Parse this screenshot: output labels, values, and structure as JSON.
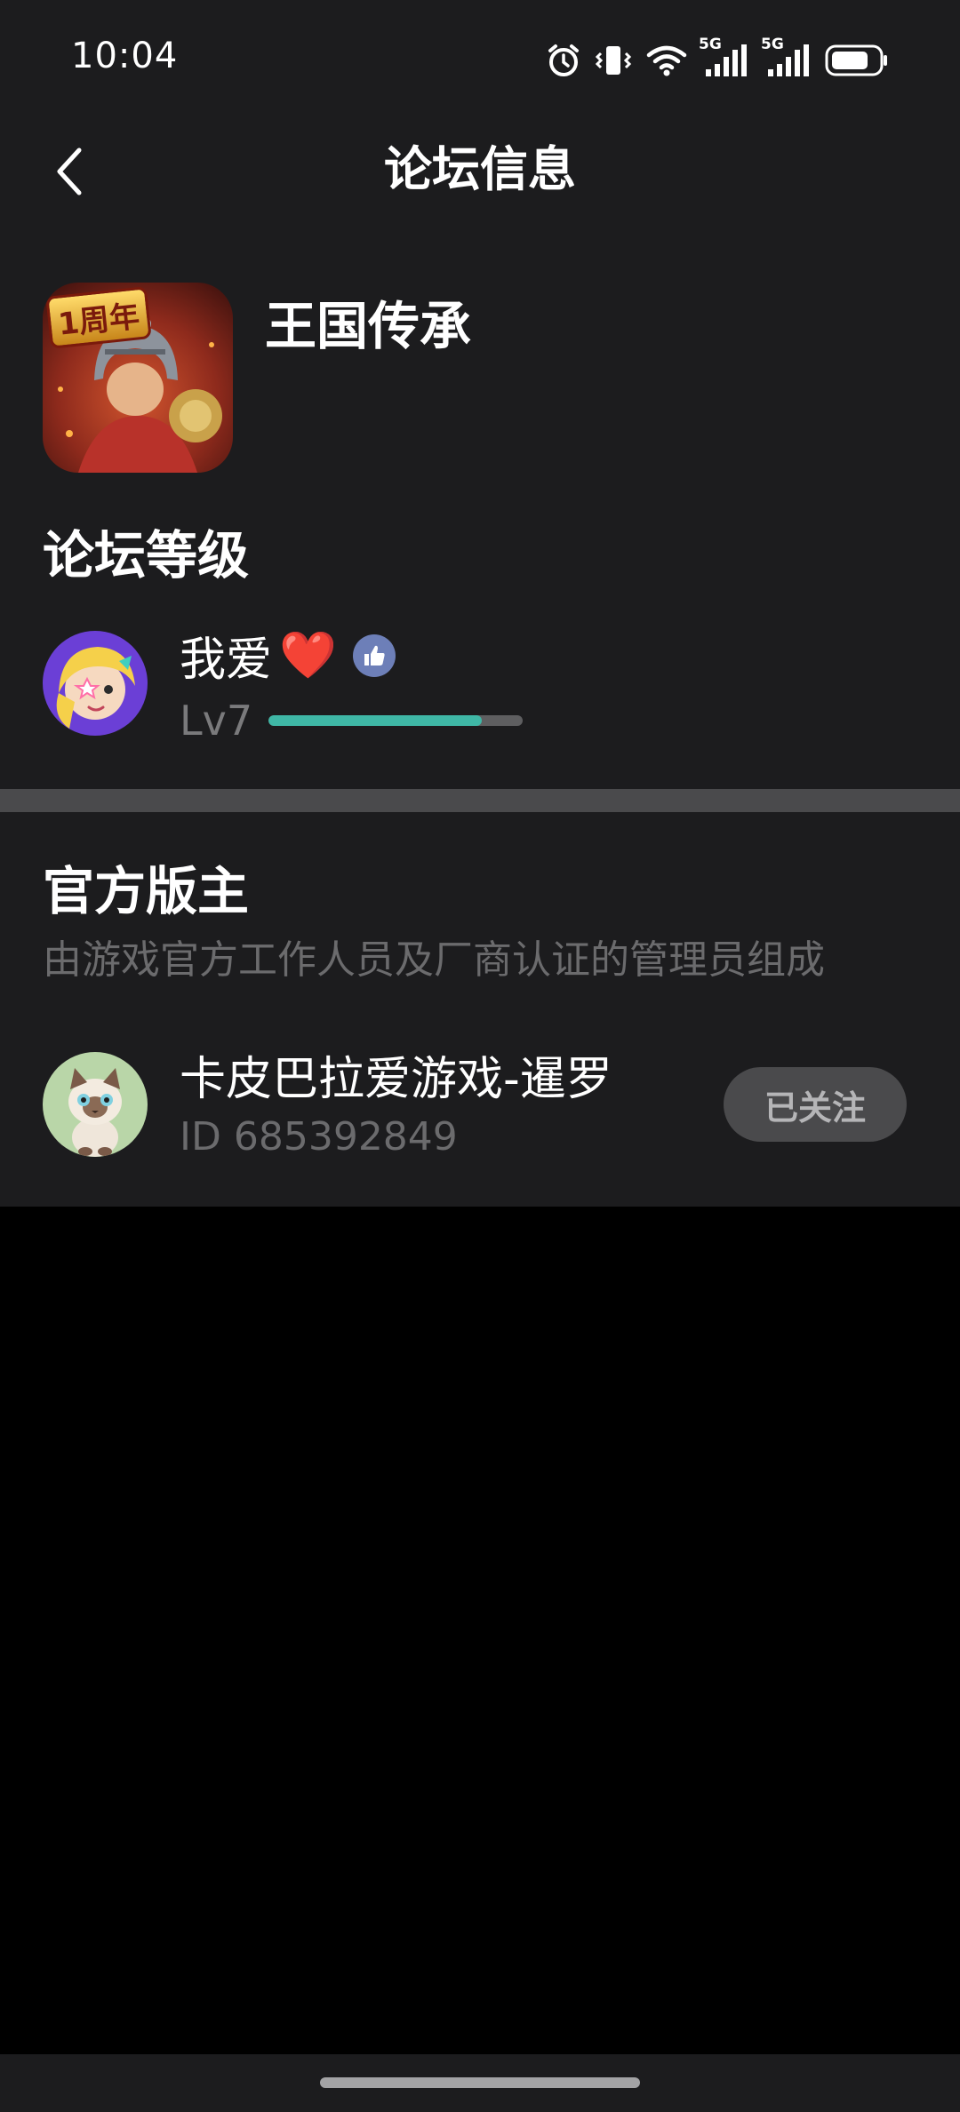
{
  "status_bar": {
    "time": "10:04",
    "network_1": "5G",
    "network_2": "5G",
    "icons": [
      "alarm-icon",
      "vibrate-icon",
      "wifi-icon",
      "signal-icon",
      "signal-icon",
      "battery-icon"
    ],
    "battery_level": 0.75
  },
  "nav": {
    "back_icon": "chevron-left-icon",
    "title": "论坛信息"
  },
  "forum": {
    "game_name": "王国传承",
    "icon_badge": "1周年"
  },
  "level_section": {
    "title": "论坛等级",
    "user_name": "我爱",
    "user_emoji": "❤️",
    "badge_icon": "thumbs-up-icon",
    "level": "Lv7",
    "progress": 0.84,
    "progress_color": "#3fb7a6"
  },
  "moderators": {
    "title": "官方版主",
    "description": "由游戏官方工作人员及厂商认证的管理员组成",
    "items": [
      {
        "name": "卡皮巴拉爱游戏-暹罗",
        "id": "ID 685392849",
        "follow_label": "已关注"
      }
    ]
  }
}
